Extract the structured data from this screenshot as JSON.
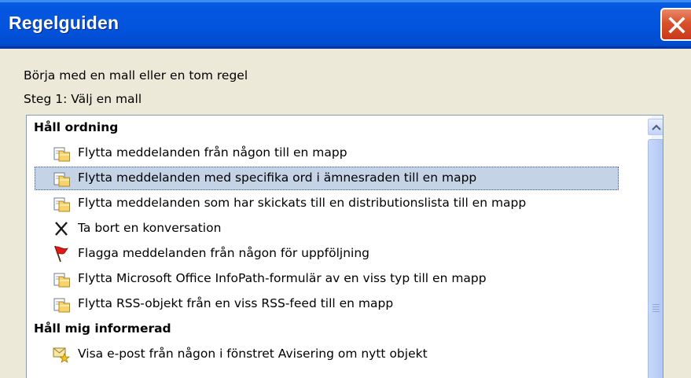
{
  "window": {
    "title": "Regelguiden",
    "close_icon": "close-icon",
    "accent": "#0455de"
  },
  "dialog": {
    "intro": "Börja med en mall eller en tom regel",
    "step": "Steg 1: Välj en mall"
  },
  "templates": {
    "groups": [
      {
        "header": "Håll ordning",
        "items": [
          {
            "label": "Flytta meddelanden från någon till en mapp",
            "icon": "folder-move-icon"
          },
          {
            "label": "Flytta meddelanden med specifika ord i ämnesraden till en mapp",
            "icon": "folder-move-icon",
            "selected": true
          },
          {
            "label": "Flytta meddelanden som har skickats till en distributionslista till en mapp",
            "icon": "folder-move-icon"
          },
          {
            "label": "Ta bort en konversation",
            "icon": "delete-x-icon"
          },
          {
            "label": "Flagga meddelanden från någon för uppföljning",
            "icon": "red-flag-icon"
          },
          {
            "label": "Flytta Microsoft Office InfoPath-formulär av en viss typ till en mapp",
            "icon": "folder-move-icon"
          },
          {
            "label": "Flytta RSS-objekt från en viss RSS-feed till en mapp",
            "icon": "folder-move-icon"
          }
        ]
      },
      {
        "header": "Håll mig informerad",
        "items": [
          {
            "label": "Visa e-post från någon i fönstret Avisering om nytt objekt",
            "icon": "mail-alert-icon"
          }
        ]
      }
    ],
    "selection_color": "#c5d3e6"
  },
  "scrollbar": {
    "up_icon": "chevron-up-icon"
  }
}
